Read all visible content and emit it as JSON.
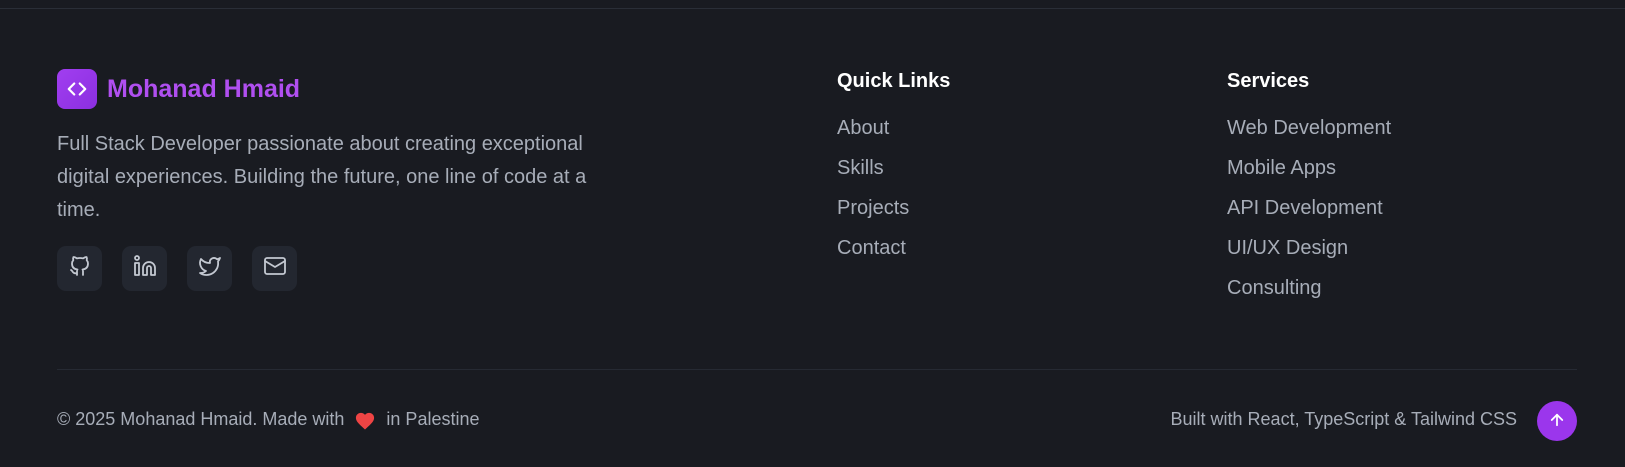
{
  "brand": {
    "name": "Mohanad Hmaid",
    "logo_icon": "code-brackets-icon",
    "accent": "#a13ef0"
  },
  "bio": "Full Stack Developer passionate about creating exceptional digital experiences. Building the future, one line of code at a time.",
  "socials": [
    {
      "icon": "github-icon"
    },
    {
      "icon": "linkedin-icon"
    },
    {
      "icon": "twitter-icon"
    },
    {
      "icon": "mail-icon"
    }
  ],
  "quick_links": {
    "title": "Quick Links",
    "items": [
      "About",
      "Skills",
      "Projects",
      "Contact"
    ]
  },
  "services": {
    "title": "Services",
    "items": [
      "Web Development",
      "Mobile Apps",
      "API Development",
      "UI/UX Design",
      "Consulting"
    ]
  },
  "bottom": {
    "copyright_prefix": "© 2025 Mohanad Hmaid. Made with",
    "heart_icon": "heart-icon",
    "heart_color": "#ef4444",
    "copyright_suffix": "in Palestine",
    "built_with": "Built with React, TypeScript & Tailwind CSS",
    "top_button_icon": "arrow-up-icon"
  }
}
